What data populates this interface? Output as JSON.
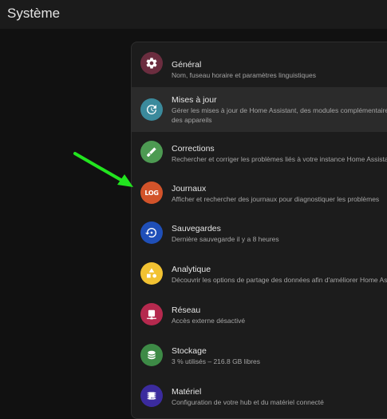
{
  "header": {
    "title": "Système"
  },
  "menu": {
    "items": [
      {
        "label": "Général",
        "description": "Nom, fuseau horaire et paramètres linguistiques",
        "icon": "gear-icon",
        "color": "#6b2d3f"
      },
      {
        "label": "Mises à jour",
        "description": "Gérer les mises à jour de Home Assistant, des modules complémentaires, des appareils",
        "icon": "update-icon",
        "color": "#3b8a9c"
      },
      {
        "label": "Corrections",
        "description": "Rechercher et corriger les problèmes liés à votre instance Home Assistant",
        "icon": "bandage-icon",
        "color": "#4d9a52"
      },
      {
        "label": "Journaux",
        "description": "Afficher et rechercher des journaux pour diagnostiquer les problèmes",
        "icon": "log-icon",
        "icon_text": "LOG",
        "color": "#d2532a"
      },
      {
        "label": "Sauvegardes",
        "description": "Dernière sauvegarde il y a 8 heures",
        "icon": "backup-restore-icon",
        "color": "#1f4fb8"
      },
      {
        "label": "Analytique",
        "description": "Découvrir les options de partage des données afin d'améliorer Home Assistant",
        "icon": "shapes-icon",
        "color": "#f2c232"
      },
      {
        "label": "Réseau",
        "description": "Accès externe désactivé",
        "icon": "network-icon",
        "color": "#b5294e"
      },
      {
        "label": "Stockage",
        "description": "3 % utilisés – 216.8 GB libres",
        "icon": "database-icon",
        "color": "#3d8a46"
      },
      {
        "label": "Matériel",
        "description": "Configuration de votre hub et du matériel connecté",
        "icon": "chip-icon",
        "color": "#3b2b9e"
      }
    ]
  },
  "annotation": {
    "arrow_color": "#22e51f"
  }
}
